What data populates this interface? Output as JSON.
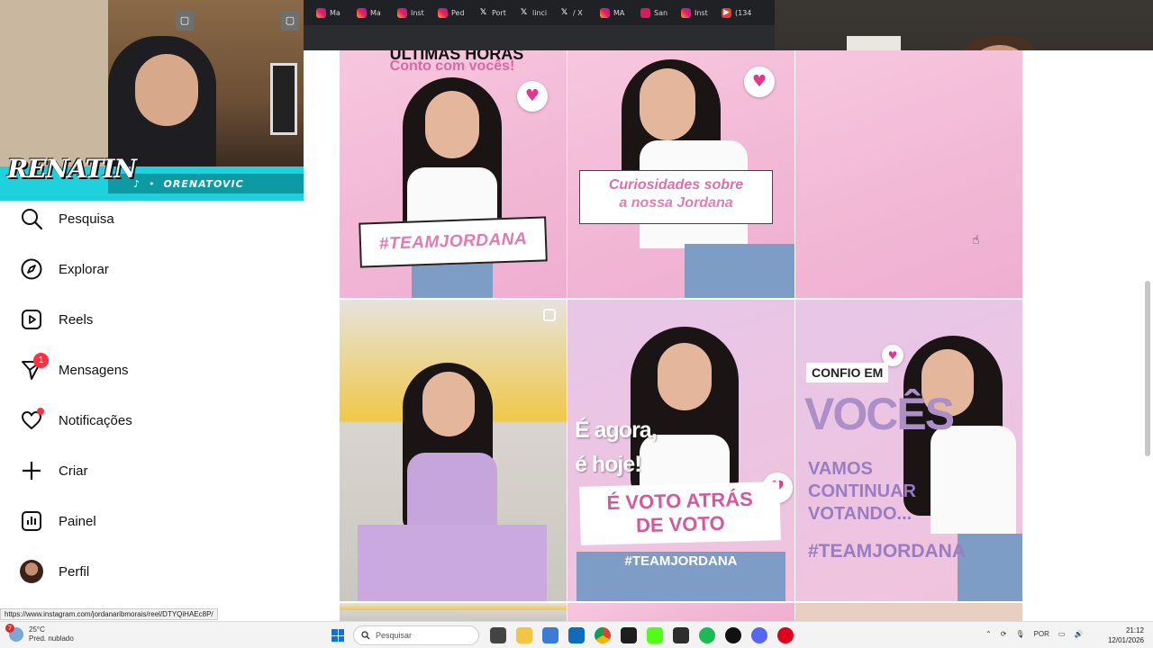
{
  "browser": {
    "tabs": [
      {
        "icon": "instagram-icon",
        "label": "Ma"
      },
      {
        "icon": "instagram-icon",
        "label": "Ma"
      },
      {
        "icon": "instagram-icon",
        "label": "Inst"
      },
      {
        "icon": "instagram-icon",
        "label": "Ped"
      },
      {
        "icon": "x-icon",
        "label": "Port"
      },
      {
        "icon": "x-icon",
        "label": "linci"
      },
      {
        "icon": "x-icon",
        "label": "/ X"
      },
      {
        "icon": "instagram-icon",
        "label": "MA"
      },
      {
        "icon": "instagram-icon",
        "label": "San"
      },
      {
        "icon": "instagram-icon",
        "label": "Inst"
      },
      {
        "icon": "youtube-icon",
        "label": "(134"
      }
    ]
  },
  "overlay": {
    "logo": "RENATIN",
    "handle": "ORENATOVIC"
  },
  "sidebar": {
    "items": [
      {
        "label": "Pesquisa",
        "icon": "search-icon"
      },
      {
        "label": "Explorar",
        "icon": "compass-icon"
      },
      {
        "label": "Reels",
        "icon": "reels-icon"
      },
      {
        "label": "Mensagens",
        "icon": "messenger-icon",
        "badge": "1"
      },
      {
        "label": "Notificações",
        "icon": "heart-icon"
      },
      {
        "label": "Criar",
        "icon": "plus-icon"
      },
      {
        "label": "Painel",
        "icon": "dashboard-icon"
      },
      {
        "label": "Perfil",
        "icon": "avatar"
      }
    ]
  },
  "posts": {
    "p1": {
      "title": "ÚLTIMAS HORAS",
      "subtitle": "Conto com vocês!",
      "tag": "#TEAMJORDANA"
    },
    "p2": {
      "line1": "Curiosidades sobre",
      "line2": "a nossa Jordana"
    },
    "p5": {
      "line1": "É agora,",
      "line2": "é hoje!",
      "card1": "É VOTO ATRÁS",
      "card2": "DE VOTO",
      "tag": "#TEAMJORDANA"
    },
    "p6": {
      "confio": "CONFIO EM",
      "voces": "VOCÊS",
      "vamos1": "VAMOS",
      "vamos2": "CONTINUAR",
      "vamos3": "VOTANDO...",
      "tag": "#TEAMJORDANA"
    }
  },
  "status_url": "https://www.instagram.com/jordanaribmorais/reel/DTYQiHAEc8P/",
  "taskbar": {
    "temperature": "25°C",
    "weather": "Pred. nublado",
    "weather_badge": "7",
    "search_placeholder": "Pesquisar",
    "language": "POR",
    "time": "21:12",
    "date": "12/01/2026"
  },
  "colors": {
    "brand_pink": "#e6358f",
    "overlay_cyan": "#1fd1dc",
    "notification_red": "#ff3040"
  }
}
